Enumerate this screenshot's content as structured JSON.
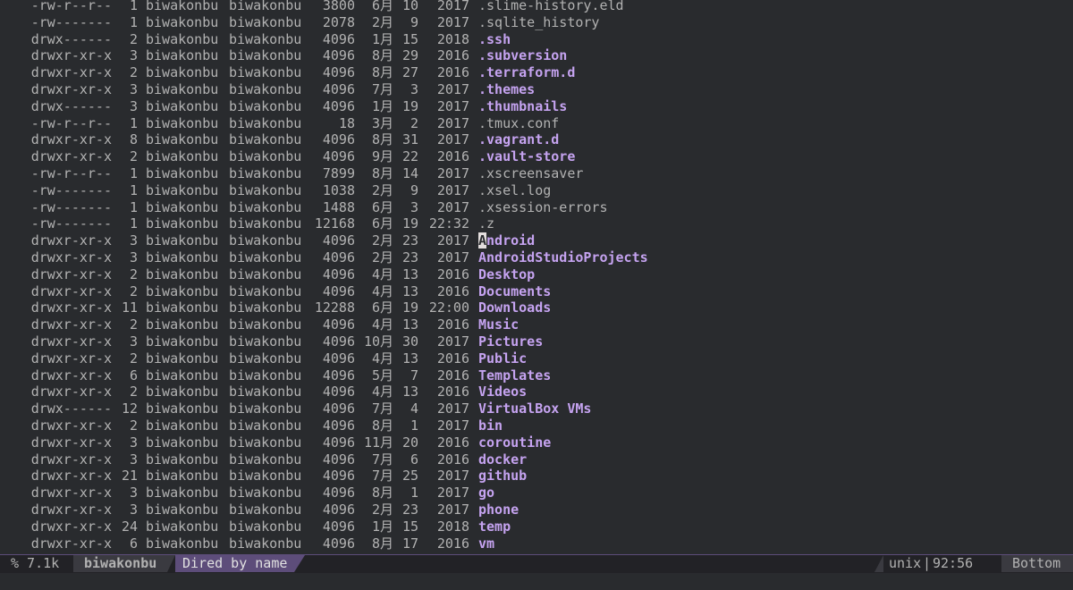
{
  "window": {
    "cursor_char": "A"
  },
  "rows": [
    {
      "perm": "-rw-r--r--",
      "links": "1",
      "owner": "biwakonbu",
      "group": "biwakonbu",
      "size": "3800",
      "month": "6月",
      "day": "10",
      "yt": "2017",
      "name": ".slime-history.eld",
      "dir": false
    },
    {
      "perm": "-rw-------",
      "links": "1",
      "owner": "biwakonbu",
      "group": "biwakonbu",
      "size": "2078",
      "month": "2月",
      "day": "9",
      "yt": "2017",
      "name": ".sqlite_history",
      "dir": false
    },
    {
      "perm": "drwx------",
      "links": "2",
      "owner": "biwakonbu",
      "group": "biwakonbu",
      "size": "4096",
      "month": "1月",
      "day": "15",
      "yt": "2018",
      "name": ".ssh",
      "dir": true
    },
    {
      "perm": "drwxr-xr-x",
      "links": "3",
      "owner": "biwakonbu",
      "group": "biwakonbu",
      "size": "4096",
      "month": "8月",
      "day": "29",
      "yt": "2016",
      "name": ".subversion",
      "dir": true
    },
    {
      "perm": "drwxr-xr-x",
      "links": "2",
      "owner": "biwakonbu",
      "group": "biwakonbu",
      "size": "4096",
      "month": "8月",
      "day": "27",
      "yt": "2016",
      "name": ".terraform.d",
      "dir": true
    },
    {
      "perm": "drwxr-xr-x",
      "links": "3",
      "owner": "biwakonbu",
      "group": "biwakonbu",
      "size": "4096",
      "month": "7月",
      "day": "3",
      "yt": "2017",
      "name": ".themes",
      "dir": true
    },
    {
      "perm": "drwx------",
      "links": "3",
      "owner": "biwakonbu",
      "group": "biwakonbu",
      "size": "4096",
      "month": "1月",
      "day": "19",
      "yt": "2017",
      "name": ".thumbnails",
      "dir": true
    },
    {
      "perm": "-rw-r--r--",
      "links": "1",
      "owner": "biwakonbu",
      "group": "biwakonbu",
      "size": "18",
      "month": "3月",
      "day": "2",
      "yt": "2017",
      "name": ".tmux.conf",
      "dir": false
    },
    {
      "perm": "drwxr-xr-x",
      "links": "8",
      "owner": "biwakonbu",
      "group": "biwakonbu",
      "size": "4096",
      "month": "8月",
      "day": "31",
      "yt": "2017",
      "name": ".vagrant.d",
      "dir": true
    },
    {
      "perm": "drwxr-xr-x",
      "links": "2",
      "owner": "biwakonbu",
      "group": "biwakonbu",
      "size": "4096",
      "month": "9月",
      "day": "22",
      "yt": "2016",
      "name": ".vault-store",
      "dir": true
    },
    {
      "perm": "-rw-r--r--",
      "links": "1",
      "owner": "biwakonbu",
      "group": "biwakonbu",
      "size": "7899",
      "month": "8月",
      "day": "14",
      "yt": "2017",
      "name": ".xscreensaver",
      "dir": false
    },
    {
      "perm": "-rw-------",
      "links": "1",
      "owner": "biwakonbu",
      "group": "biwakonbu",
      "size": "1038",
      "month": "2月",
      "day": "9",
      "yt": "2017",
      "name": ".xsel.log",
      "dir": false
    },
    {
      "perm": "-rw-------",
      "links": "1",
      "owner": "biwakonbu",
      "group": "biwakonbu",
      "size": "1488",
      "month": "6月",
      "day": "3",
      "yt": "2017",
      "name": ".xsession-errors",
      "dir": false
    },
    {
      "perm": "-rw-------",
      "links": "1",
      "owner": "biwakonbu",
      "group": "biwakonbu",
      "size": "12168",
      "month": "6月",
      "day": "19",
      "yt": "22:32",
      "name": ".z",
      "dir": false
    },
    {
      "perm": "drwxr-xr-x",
      "links": "3",
      "owner": "biwakonbu",
      "group": "biwakonbu",
      "size": "4096",
      "month": "2月",
      "day": "23",
      "yt": "2017",
      "name": "Android",
      "dir": true,
      "cursor": true
    },
    {
      "perm": "drwxr-xr-x",
      "links": "3",
      "owner": "biwakonbu",
      "group": "biwakonbu",
      "size": "4096",
      "month": "2月",
      "day": "23",
      "yt": "2017",
      "name": "AndroidStudioProjects",
      "dir": true
    },
    {
      "perm": "drwxr-xr-x",
      "links": "2",
      "owner": "biwakonbu",
      "group": "biwakonbu",
      "size": "4096",
      "month": "4月",
      "day": "13",
      "yt": "2016",
      "name": "Desktop",
      "dir": true
    },
    {
      "perm": "drwxr-xr-x",
      "links": "2",
      "owner": "biwakonbu",
      "group": "biwakonbu",
      "size": "4096",
      "month": "4月",
      "day": "13",
      "yt": "2016",
      "name": "Documents",
      "dir": true
    },
    {
      "perm": "drwxr-xr-x",
      "links": "11",
      "owner": "biwakonbu",
      "group": "biwakonbu",
      "size": "12288",
      "month": "6月",
      "day": "19",
      "yt": "22:00",
      "name": "Downloads",
      "dir": true
    },
    {
      "perm": "drwxr-xr-x",
      "links": "2",
      "owner": "biwakonbu",
      "group": "biwakonbu",
      "size": "4096",
      "month": "4月",
      "day": "13",
      "yt": "2016",
      "name": "Music",
      "dir": true
    },
    {
      "perm": "drwxr-xr-x",
      "links": "3",
      "owner": "biwakonbu",
      "group": "biwakonbu",
      "size": "4096",
      "month": "10月",
      "day": "30",
      "yt": "2017",
      "name": "Pictures",
      "dir": true
    },
    {
      "perm": "drwxr-xr-x",
      "links": "2",
      "owner": "biwakonbu",
      "group": "biwakonbu",
      "size": "4096",
      "month": "4月",
      "day": "13",
      "yt": "2016",
      "name": "Public",
      "dir": true
    },
    {
      "perm": "drwxr-xr-x",
      "links": "6",
      "owner": "biwakonbu",
      "group": "biwakonbu",
      "size": "4096",
      "month": "5月",
      "day": "7",
      "yt": "2016",
      "name": "Templates",
      "dir": true
    },
    {
      "perm": "drwxr-xr-x",
      "links": "2",
      "owner": "biwakonbu",
      "group": "biwakonbu",
      "size": "4096",
      "month": "4月",
      "day": "13",
      "yt": "2016",
      "name": "Videos",
      "dir": true
    },
    {
      "perm": "drwx------",
      "links": "12",
      "owner": "biwakonbu",
      "group": "biwakonbu",
      "size": "4096",
      "month": "7月",
      "day": "4",
      "yt": "2017",
      "name": "VirtualBox VMs",
      "dir": true
    },
    {
      "perm": "drwxr-xr-x",
      "links": "2",
      "owner": "biwakonbu",
      "group": "biwakonbu",
      "size": "4096",
      "month": "8月",
      "day": "1",
      "yt": "2017",
      "name": "bin",
      "dir": true
    },
    {
      "perm": "drwxr-xr-x",
      "links": "3",
      "owner": "biwakonbu",
      "group": "biwakonbu",
      "size": "4096",
      "month": "11月",
      "day": "20",
      "yt": "2016",
      "name": "coroutine",
      "dir": true
    },
    {
      "perm": "drwxr-xr-x",
      "links": "3",
      "owner": "biwakonbu",
      "group": "biwakonbu",
      "size": "4096",
      "month": "7月",
      "day": "6",
      "yt": "2016",
      "name": "docker",
      "dir": true
    },
    {
      "perm": "drwxr-xr-x",
      "links": "21",
      "owner": "biwakonbu",
      "group": "biwakonbu",
      "size": "4096",
      "month": "7月",
      "day": "25",
      "yt": "2017",
      "name": "github",
      "dir": true
    },
    {
      "perm": "drwxr-xr-x",
      "links": "3",
      "owner": "biwakonbu",
      "group": "biwakonbu",
      "size": "4096",
      "month": "8月",
      "day": "1",
      "yt": "2017",
      "name": "go",
      "dir": true
    },
    {
      "perm": "drwxr-xr-x",
      "links": "3",
      "owner": "biwakonbu",
      "group": "biwakonbu",
      "size": "4096",
      "month": "2月",
      "day": "23",
      "yt": "2017",
      "name": "phone",
      "dir": true
    },
    {
      "perm": "drwxr-xr-x",
      "links": "24",
      "owner": "biwakonbu",
      "group": "biwakonbu",
      "size": "4096",
      "month": "1月",
      "day": "15",
      "yt": "2018",
      "name": "temp",
      "dir": true
    },
    {
      "perm": "drwxr-xr-x",
      "links": "6",
      "owner": "biwakonbu",
      "group": "biwakonbu",
      "size": "4096",
      "month": "8月",
      "day": "17",
      "yt": "2016",
      "name": "vm",
      "dir": true
    }
  ],
  "modeline": {
    "size": "% 7.1k",
    "buffer": "biwakonbu",
    "mode": "Dired by name",
    "encoding": "unix",
    "separator": "|",
    "position": "92:56",
    "scroll": "Bottom"
  },
  "colors": {
    "background": "#292b2e",
    "text": "#b2b2b2",
    "directory": "#c5a3f0",
    "modeline_accent": "#5d4d7a"
  }
}
